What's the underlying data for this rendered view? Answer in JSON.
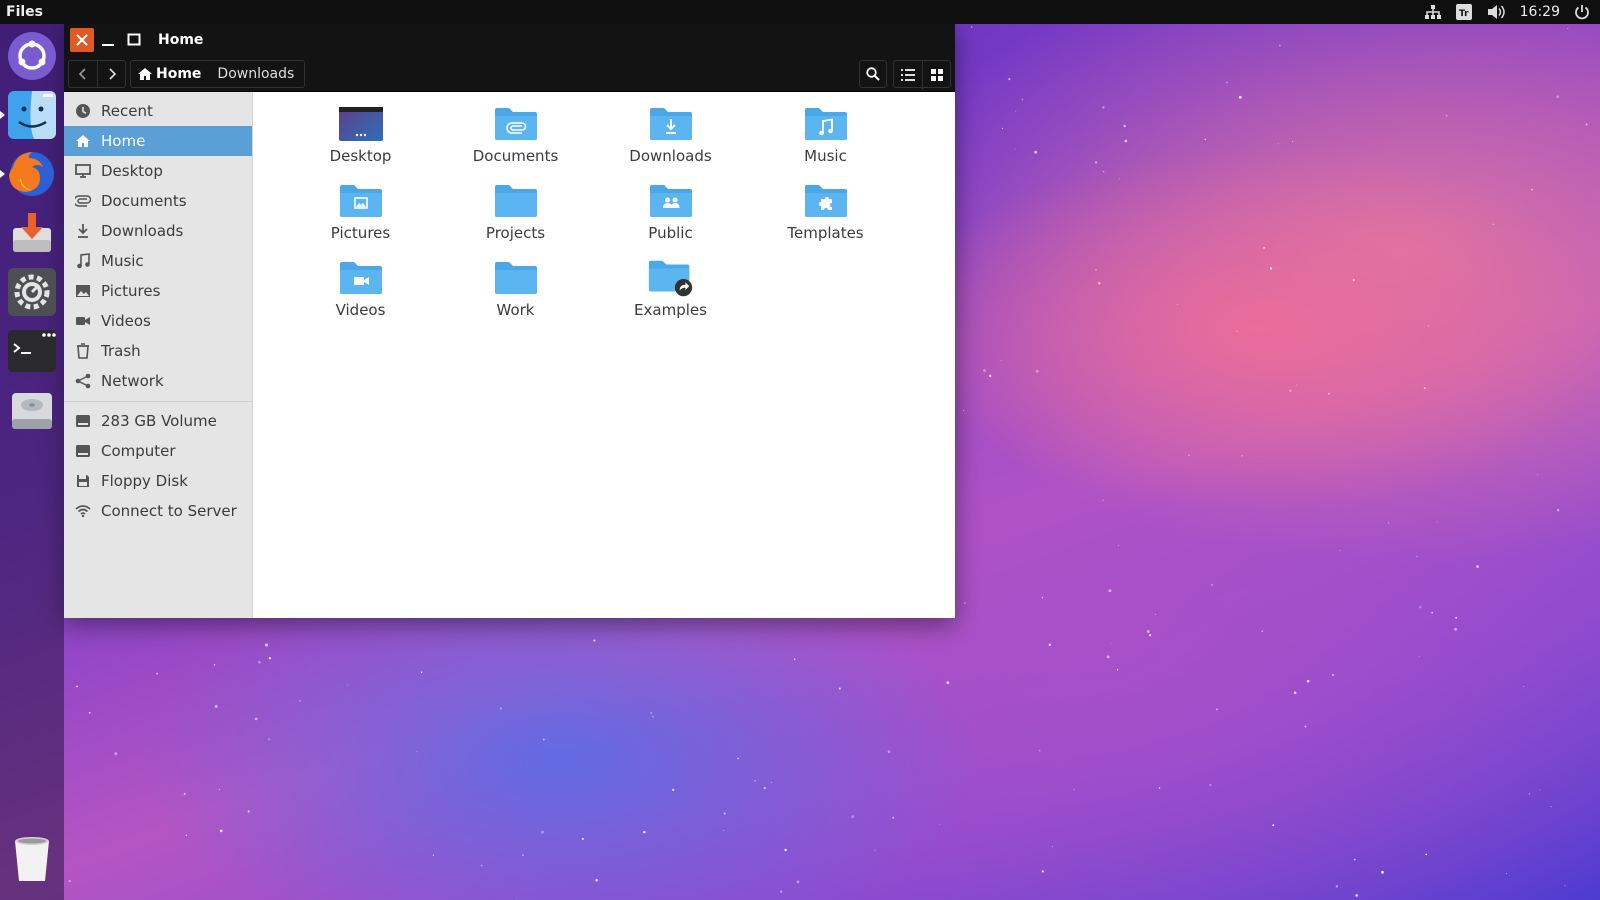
{
  "top_panel": {
    "app_name": "Files",
    "clock": "16:29",
    "indicators": [
      "network-icon",
      "keyboard-layout-icon",
      "volume-icon",
      "power-icon"
    ]
  },
  "launcher": {
    "items": [
      {
        "name": "ubuntu-dash",
        "icon": "ubuntu-logo-icon"
      },
      {
        "name": "files",
        "icon": "finder-face-icon",
        "active": true
      },
      {
        "name": "firefox",
        "icon": "firefox-icon",
        "active": true
      },
      {
        "name": "software-center",
        "icon": "download-box-icon"
      },
      {
        "name": "system-settings",
        "icon": "gear-icon"
      },
      {
        "name": "terminal",
        "icon": "terminal-icon"
      },
      {
        "name": "disk",
        "icon": "hard-drive-icon"
      }
    ],
    "trash_icon": "trash-can-icon"
  },
  "window": {
    "title": "Home",
    "breadcrumbs": [
      {
        "label": "Home",
        "current": true
      },
      {
        "label": "Downloads",
        "current": false
      }
    ]
  },
  "sidebar": {
    "places": [
      {
        "label": "Recent",
        "icon": "clock-icon"
      },
      {
        "label": "Home",
        "icon": "home-icon",
        "selected": true
      },
      {
        "label": "Desktop",
        "icon": "monitor-icon"
      },
      {
        "label": "Documents",
        "icon": "paperclip-icon"
      },
      {
        "label": "Downloads",
        "icon": "download-arrow-icon"
      },
      {
        "label": "Music",
        "icon": "music-note-icon"
      },
      {
        "label": "Pictures",
        "icon": "image-icon"
      },
      {
        "label": "Videos",
        "icon": "video-camera-icon"
      },
      {
        "label": "Trash",
        "icon": "trash-icon"
      },
      {
        "label": "Network",
        "icon": "share-network-icon"
      }
    ],
    "devices": [
      {
        "label": "283 GB Volume",
        "icon": "drive-icon"
      },
      {
        "label": "Computer",
        "icon": "drive-icon"
      },
      {
        "label": "Floppy Disk",
        "icon": "floppy-icon"
      },
      {
        "label": "Connect to Server",
        "icon": "wifi-icon"
      }
    ]
  },
  "files": [
    {
      "label": "Desktop",
      "icon": "desktop-folder-icon"
    },
    {
      "label": "Documents",
      "icon": "documents-folder-icon"
    },
    {
      "label": "Downloads",
      "icon": "downloads-folder-icon"
    },
    {
      "label": "Music",
      "icon": "music-folder-icon"
    },
    {
      "label": "Pictures",
      "icon": "pictures-folder-icon"
    },
    {
      "label": "Projects",
      "icon": "folder-icon"
    },
    {
      "label": "Public",
      "icon": "public-folder-icon"
    },
    {
      "label": "Templates",
      "icon": "templates-folder-icon"
    },
    {
      "label": "Videos",
      "icon": "videos-folder-icon"
    },
    {
      "label": "Work",
      "icon": "folder-icon"
    },
    {
      "label": "Examples",
      "icon": "examples-link-folder-icon"
    }
  ],
  "colors": {
    "accent": "#5a9fd6",
    "folder": "#4aa8e8",
    "close_button": "#e05a24",
    "titlebar": "#131313"
  }
}
